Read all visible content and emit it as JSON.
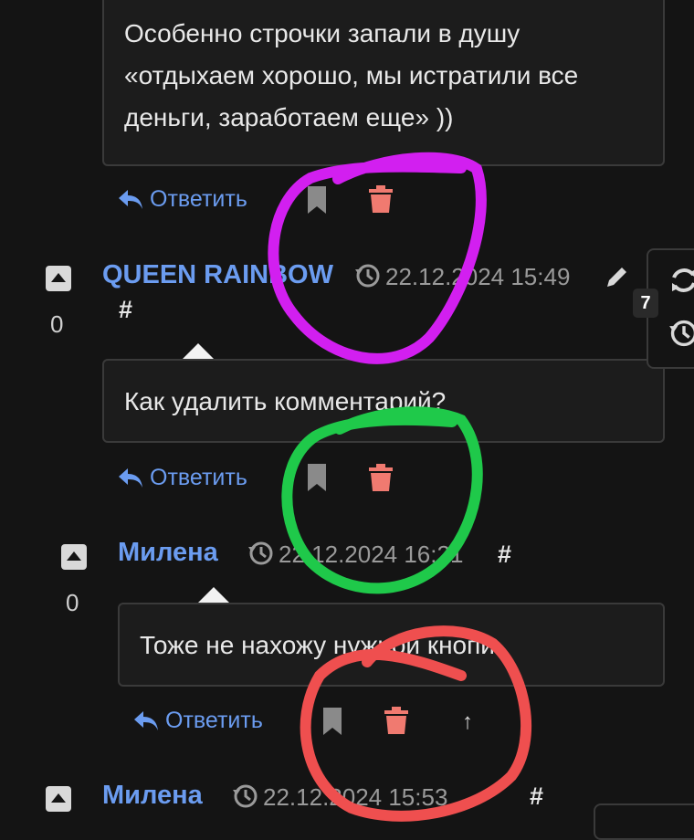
{
  "comments": [
    {
      "text_lines": [
        "Особенно строчки запали в душу",
        "«отдыхаем хорошо, мы истратили все",
        "деньги, заработаем еще» ))"
      ],
      "reply_label": "Ответить"
    },
    {
      "score": "0",
      "author": "QUEEN RAINBOW",
      "time": "22.12.2024 15:49",
      "hash": "#",
      "text": "Как удалить комментарий?",
      "reply_label": "Ответить"
    },
    {
      "score": "0",
      "author": "Милена",
      "time": "22.12.2024 16:21",
      "hash": "#",
      "text": "Тоже не нахожу нужной кнопи.",
      "reply_label": "Ответить",
      "up_arrow": "↑"
    },
    {
      "author": "Милена",
      "time": "22.12.2024 15:53",
      "hash": "#"
    }
  ],
  "side_panel": {
    "badge_count": "7"
  },
  "annotations": {
    "circle_colors": [
      "#d21ff0",
      "#1fc94a",
      "#ef4f4f"
    ]
  },
  "colors": {
    "link": "#6b9cf0",
    "delete_icon": "#f07a70",
    "bookmark_icon": "#8a8a8a"
  }
}
